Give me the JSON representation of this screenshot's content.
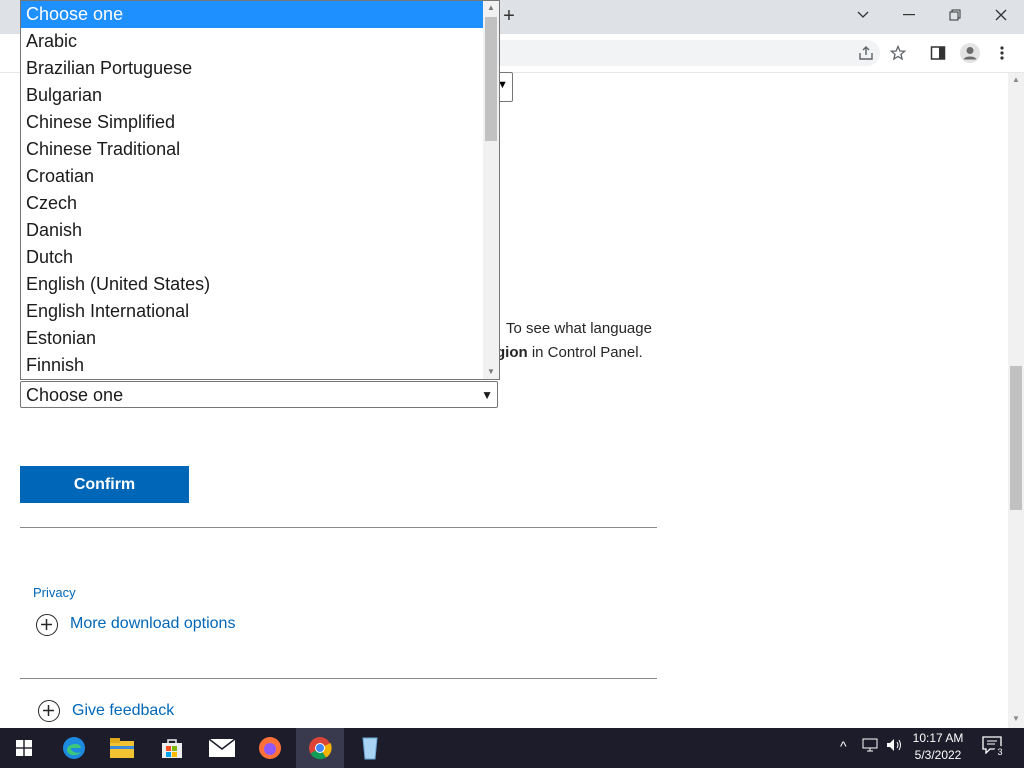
{
  "browser": {
    "new_tab": "+",
    "window_controls": [
      "chevron-down-icon",
      "minimize-icon",
      "restore-icon",
      "close-icon"
    ],
    "toolbar_icons": [
      "share-icon",
      "star-icon",
      "sidepanel-icon",
      "profile-icon",
      "kebab-menu-icon"
    ]
  },
  "page": {
    "note_line1": "To see what language",
    "note_line2_bold": "gion",
    "note_line2_rest": " in Control Panel.",
    "select_value": "Choose one",
    "confirm_label": "Confirm",
    "privacy_label": "Privacy",
    "more_download_label": "More download options",
    "give_feedback_label": "Give feedback"
  },
  "dropdown": {
    "selected_index": 0,
    "options": [
      "Choose one",
      "Arabic",
      "Brazilian Portuguese",
      "Bulgarian",
      "Chinese Simplified",
      "Chinese Traditional",
      "Croatian",
      "Czech",
      "Danish",
      "Dutch",
      "English (United States)",
      "English International",
      "Estonian",
      "Finnish"
    ]
  },
  "taskbar": {
    "apps": [
      "edge-icon",
      "file-explorer-icon",
      "store-icon",
      "mail-icon",
      "firefox-icon",
      "chrome-icon",
      "recycle-bin-icon"
    ],
    "time": "10:17 AM",
    "date": "5/3/2022",
    "notification_count": "3"
  },
  "colors": {
    "accent": "#0067b8",
    "selected_option": "#1e90ff",
    "taskbar": "#1c1c2b"
  }
}
